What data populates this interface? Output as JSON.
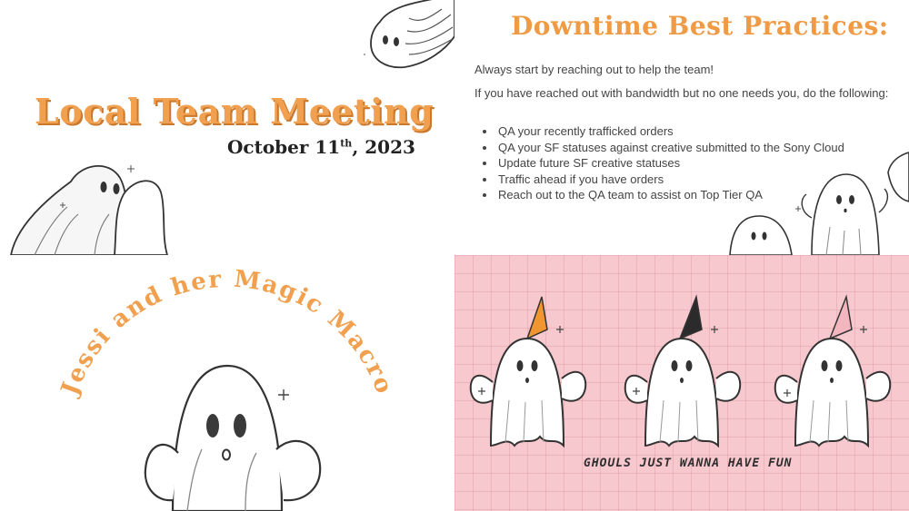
{
  "slide_meeting": {
    "title": "Local Team Meeting",
    "date_month_day": "October 11",
    "date_suffix": "th",
    "date_year": ", 2023"
  },
  "slide_practices": {
    "title": "Downtime Best Practices:",
    "intro": "Always start by reaching out to help the team!",
    "condition": "If you have reached out with bandwidth but no one needs you, do the following:",
    "bullets": [
      "QA your recently trafficked orders",
      "QA your SF statuses against creative submitted to the Sony Cloud",
      "Update future SF creative statuses",
      "Traffic ahead if you have orders",
      "Reach out to the QA team to assist on Top Tier QA"
    ]
  },
  "slide_macro": {
    "title": "Jessi and her Magic Macro"
  },
  "slide_ghouls": {
    "caption": "GHOULS JUST WANNA HAVE FUN",
    "hat_colors": [
      "#f0952f",
      "#2b2b2b",
      "#f3b6bf"
    ]
  },
  "colors": {
    "accent_orange": "#f0a04e",
    "pink_background": "#f7c9cf"
  }
}
